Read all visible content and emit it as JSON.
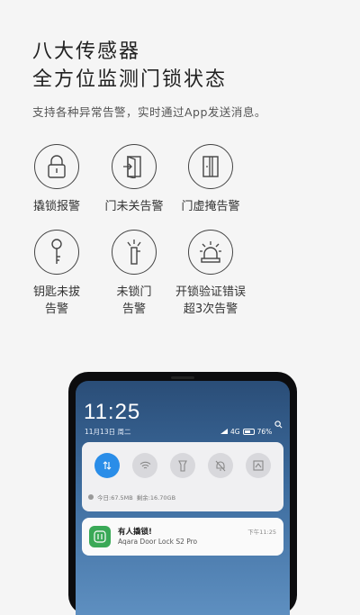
{
  "header": {
    "title_line1": "八大传感器",
    "title_line2": "全方位监测门锁状态",
    "subtitle": "支持各种异常告警，实时通过App发送消息。"
  },
  "features": [
    {
      "label": "撬锁报警",
      "icon": "lock-icon"
    },
    {
      "label": "门未关告警",
      "icon": "door-open-icon"
    },
    {
      "label": "门虚掩告警",
      "icon": "door-ajar-icon"
    },
    {
      "label": "钥匙未拔\n告警",
      "icon": "key-icon"
    },
    {
      "label": "未锁门\n告警",
      "icon": "unlocked-bolt-icon"
    },
    {
      "label": "开锁验证错误\n超3次告警",
      "icon": "alarm-siren-icon"
    }
  ],
  "phone": {
    "time": "11:25",
    "date": "11月13日 周二",
    "status": {
      "network": "4G",
      "battery": "76%"
    },
    "quick_settings": {
      "toggles": [
        "data-toggle-icon",
        "wifi-icon",
        "flashlight-icon",
        "mute-bell-icon",
        "screenshot-icon"
      ],
      "active_index": 0,
      "storage_today": "今日:67.5MB",
      "storage_remaining": "剩余:16.70GB"
    },
    "notification": {
      "title": "有人撬锁!",
      "body": "Aqara Door Lock S2 Pro",
      "time": "下午11:25",
      "app_color": "#3aa957"
    }
  }
}
